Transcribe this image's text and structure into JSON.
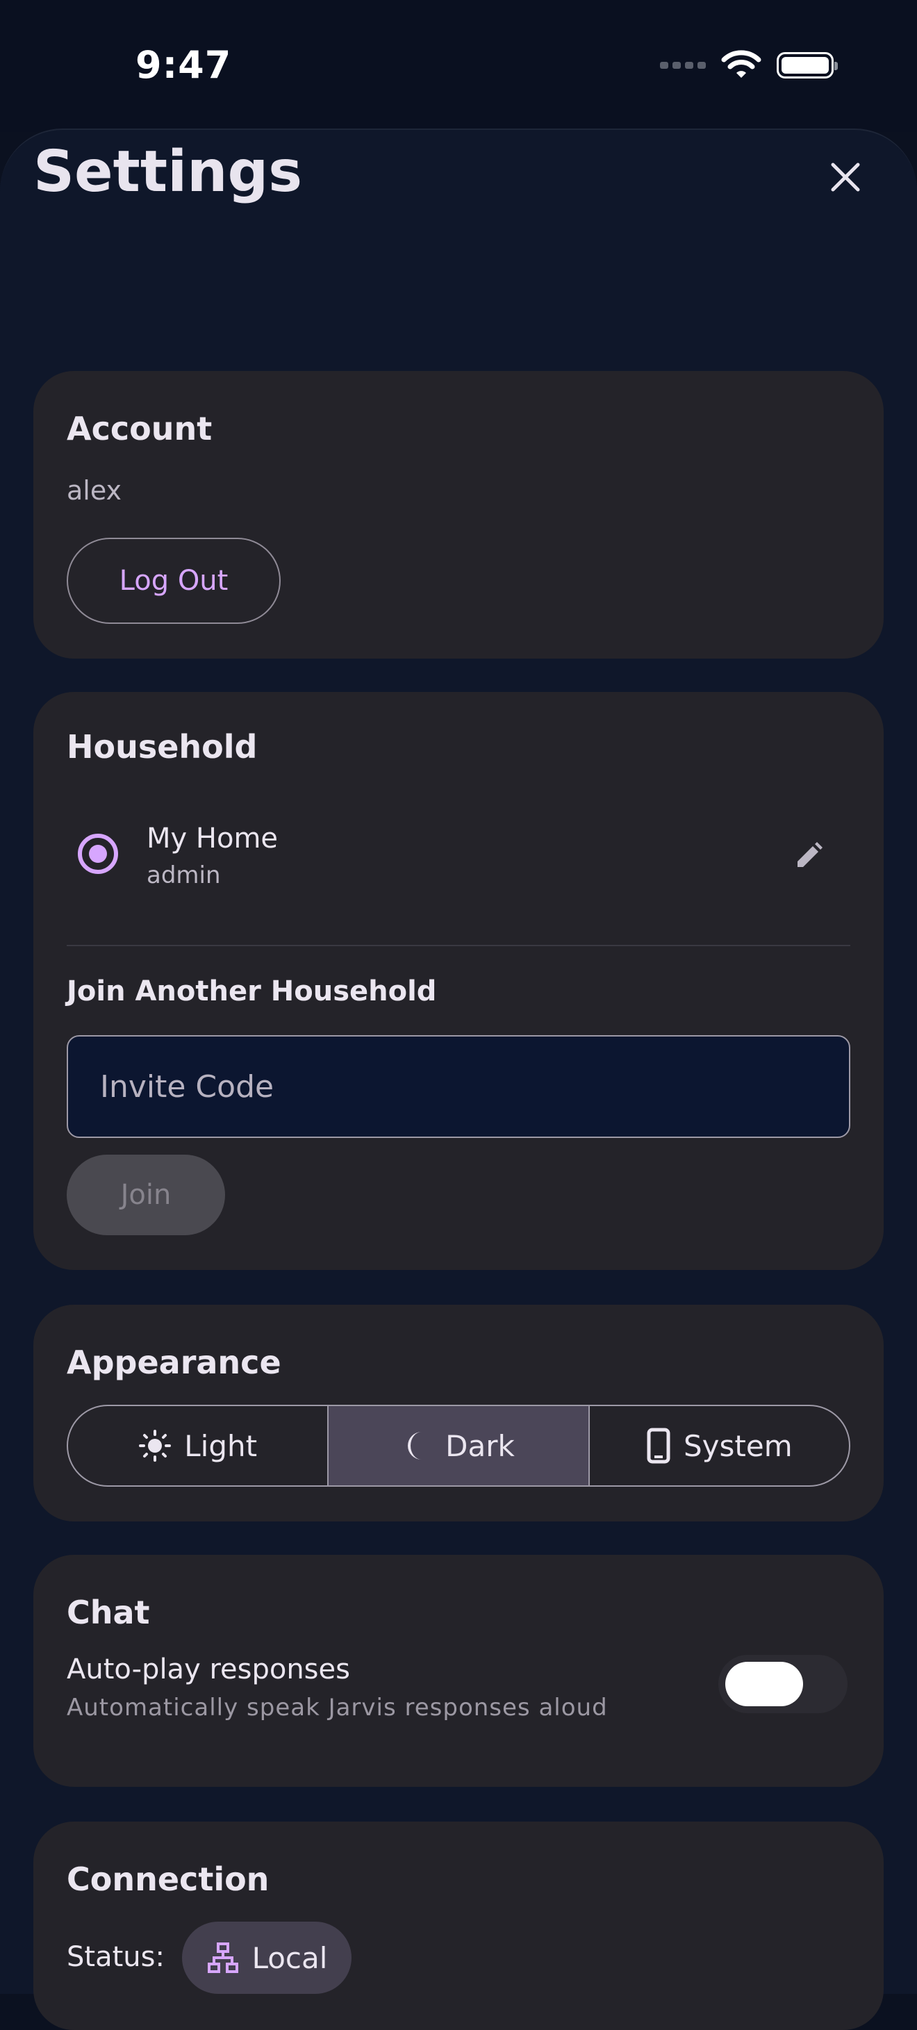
{
  "status_bar": {
    "time": "9:47"
  },
  "title": "Settings",
  "account": {
    "title": "Account",
    "username": "alex",
    "logout_label": "Log Out"
  },
  "household": {
    "title": "Household",
    "current": {
      "name": "My Home",
      "role": "admin"
    },
    "join_title": "Join Another Household",
    "invite_placeholder": "Invite Code",
    "join_label": "Join"
  },
  "appearance": {
    "title": "Appearance",
    "options": [
      {
        "label": "Light",
        "icon": "sun-icon"
      },
      {
        "label": "Dark",
        "icon": "moon-icon"
      },
      {
        "label": "System",
        "icon": "phone-icon"
      }
    ],
    "selected": "Dark"
  },
  "chat": {
    "title": "Chat",
    "autoplay_label": "Auto-play responses",
    "autoplay_desc": "Automatically speak Jarvis responses aloud",
    "autoplay_enabled": false
  },
  "connection": {
    "title": "Connection",
    "status_label": "Status:",
    "status_value": "Local",
    "status_icon": "network-icon"
  },
  "colors": {
    "accent": "#d7a6ff",
    "card": "#242329",
    "background": "#0f172a"
  }
}
